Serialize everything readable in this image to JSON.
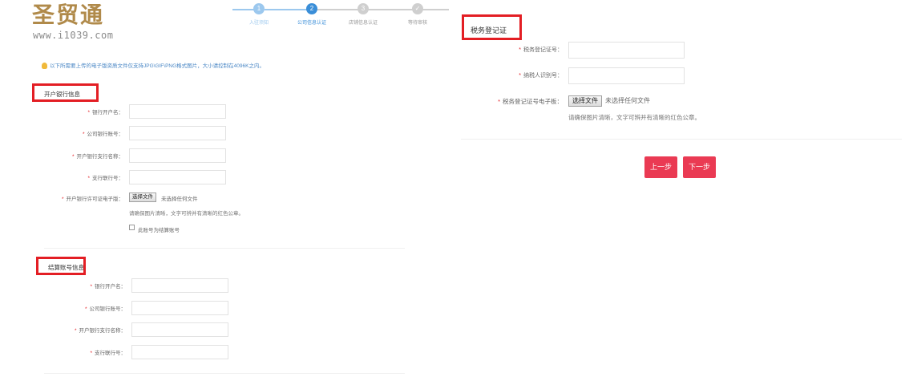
{
  "brand": {
    "logo_text": "圣贸通",
    "url": "www.i1039.com",
    "color": "#b08a4a"
  },
  "stepper": {
    "steps": [
      {
        "num": "1",
        "label": "入驻须知",
        "state": "done"
      },
      {
        "num": "2",
        "label": "公司信息认证",
        "state": "active"
      },
      {
        "num": "3",
        "label": "店铺信息认证",
        "state": "todo"
      },
      {
        "num": "✓",
        "label": "等待审核",
        "state": "todo"
      }
    ]
  },
  "notice": "以下所需要上传的电子版资质文件仅支持JPG\\GIF\\PNG格式图片，大小请控制在4096K之内。",
  "bank_section": {
    "title": "开户银行信息",
    "fields": [
      {
        "label": "银行开户名："
      },
      {
        "label": "公司银行账号："
      },
      {
        "label": "开户银行支行名称："
      },
      {
        "label": "支行联行号："
      }
    ],
    "license": {
      "label": "开户银行许可证电子版：",
      "button": "选择文件",
      "status": "未选择任何文件",
      "hint": "请确保图片清晰，文字可辨并有清晰的红色公章。"
    },
    "checkbox_label": "此账号为结算账号"
  },
  "settle_section": {
    "title": "结算账号信息",
    "fields": [
      {
        "label": "银行开户名："
      },
      {
        "label": "公司银行账号："
      },
      {
        "label": "开户银行支行名称："
      },
      {
        "label": "支行联行号："
      }
    ]
  },
  "tax_section": {
    "title": "税务登记证",
    "fields": [
      {
        "label": "税务登记证号："
      },
      {
        "label": "纳税人识别号："
      }
    ],
    "upload": {
      "label": "税务登记证号电子板：",
      "button": "选择文件",
      "status": "未选择任何文件",
      "hint": "请确保图片清晰，文字可辨并有清晰的红色公章。"
    }
  },
  "actions": {
    "prev": "上一步",
    "next": "下一步"
  },
  "colors": {
    "required": "#e31e24",
    "highlight": "#e31e24",
    "step_active": "#3a8ed8",
    "step_done": "#9cc8ee",
    "step_todo": "#cfcfcf",
    "button": "#ea3a53",
    "notice": "#4a87c5"
  }
}
